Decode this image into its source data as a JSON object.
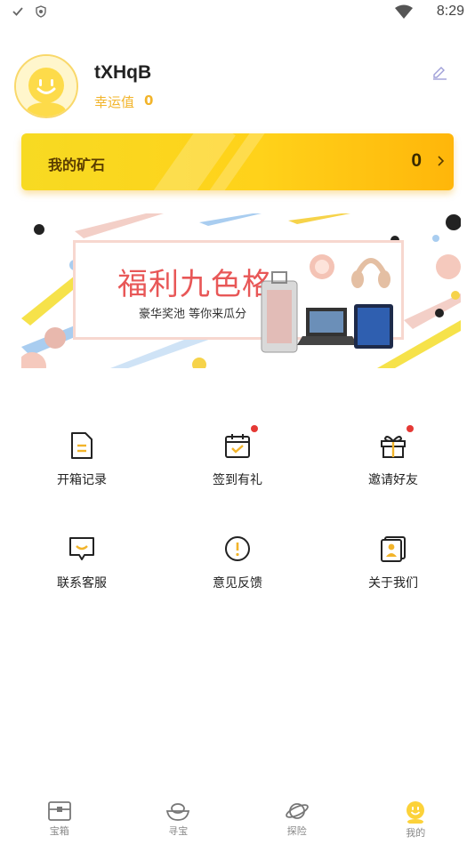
{
  "status_bar": {
    "time": "8:29"
  },
  "profile": {
    "username": "tXHqB",
    "luck_label": "幸运值",
    "luck_value": "0"
  },
  "ore_card": {
    "label": "我的矿石",
    "value": "0"
  },
  "banner": {
    "title": "福利九色格",
    "subtitle": "豪华奖池 等你来瓜分"
  },
  "grid": [
    {
      "label": "开箱记录",
      "icon": "document-icon",
      "badge": false
    },
    {
      "label": "签到有礼",
      "icon": "calendar-check-icon",
      "badge": true
    },
    {
      "label": "邀请好友",
      "icon": "gift-icon",
      "badge": true
    },
    {
      "label": "联系客服",
      "icon": "chat-smile-icon",
      "badge": false
    },
    {
      "label": "意见反馈",
      "icon": "exclamation-circle-icon",
      "badge": false
    },
    {
      "label": "关于我们",
      "icon": "id-card-icon",
      "badge": false
    }
  ],
  "bottom_nav": [
    {
      "label": "宝箱",
      "icon": "treasure-box-icon"
    },
    {
      "label": "寻宝",
      "icon": "gold-ingot-icon"
    },
    {
      "label": "探险",
      "icon": "planet-icon"
    },
    {
      "label": "我的",
      "icon": "smiley-avatar-icon",
      "active": true
    }
  ],
  "colors": {
    "accent_yellow": "#ffd21a",
    "luck_orange": "#f2b42a",
    "badge_red": "#e53935",
    "banner_red": "#e85757"
  }
}
